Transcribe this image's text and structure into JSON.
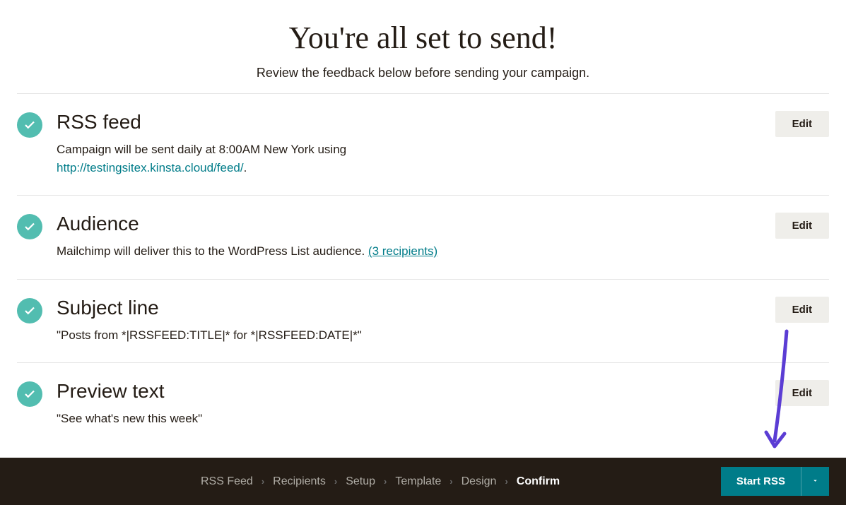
{
  "header": {
    "title": "You're all set to send!",
    "subtitle": "Review the feedback below before sending your campaign."
  },
  "sections": {
    "rss_feed": {
      "title": "RSS feed",
      "desc_prefix": "Campaign will be sent daily at 8:00AM New York using ",
      "link_text": "http://testingsitex.kinsta.cloud/feed/",
      "desc_suffix": ".",
      "edit_label": "Edit"
    },
    "audience": {
      "title": "Audience",
      "desc_prefix": "Mailchimp will deliver this to the WordPress List audience. ",
      "link_text": "(3 recipients)",
      "edit_label": "Edit"
    },
    "subject_line": {
      "title": "Subject line",
      "desc": "\"Posts from *|RSSFEED:TITLE|* for *|RSSFEED:DATE|*\"",
      "edit_label": "Edit"
    },
    "preview_text": {
      "title": "Preview text",
      "desc": "\"See what's new this week\"",
      "edit_label": "Edit"
    }
  },
  "breadcrumb": {
    "items": [
      "RSS Feed",
      "Recipients",
      "Setup",
      "Template",
      "Design",
      "Confirm"
    ],
    "active_index": 5
  },
  "footer": {
    "start_label": "Start RSS"
  }
}
